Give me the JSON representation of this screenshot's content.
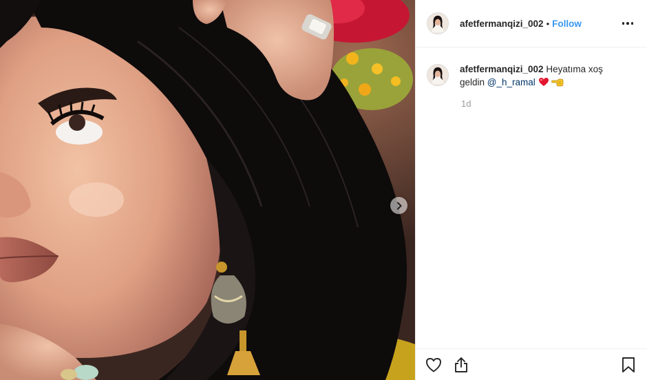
{
  "post": {
    "image_alt": "Photo by afetfermanqizi_002",
    "next_icon": "chevron-right-icon"
  },
  "header": {
    "username": "afetfermanqizi_002",
    "separator": "•",
    "follow_label": "Follow",
    "more_icon": "more-options-icon"
  },
  "caption": {
    "username": "afetfermanqizi_002",
    "text_before": "Heyatıma xoş geldin",
    "mention": "@_h_ramal",
    "emojis": [
      "red-heart-emoji",
      "backhand-index-left-emoji"
    ],
    "time": "1d"
  },
  "actions": {
    "like_icon": "heart-icon",
    "share_icon": "share-icon",
    "save_icon": "bookmark-icon"
  },
  "colors": {
    "link_blue": "#3897f0",
    "mention_blue": "#003569",
    "muted": "#999999",
    "border": "#efefef"
  }
}
